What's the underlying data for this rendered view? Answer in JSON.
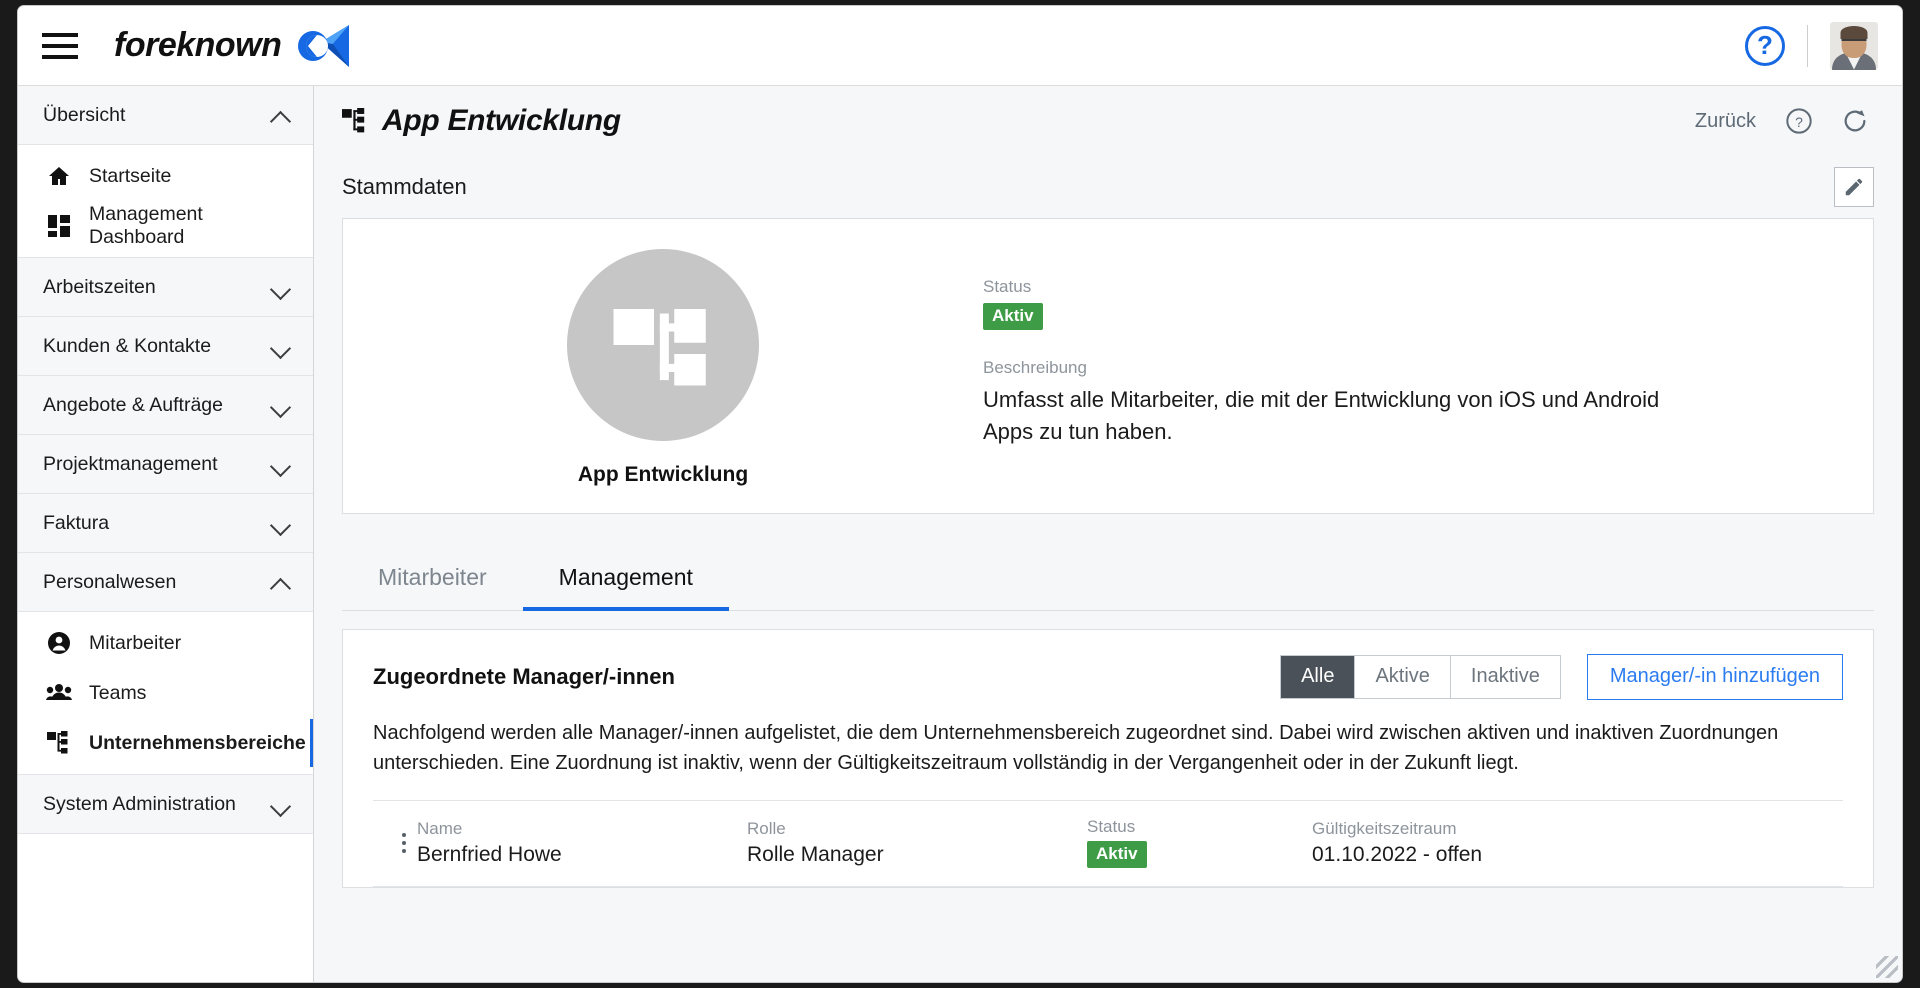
{
  "colors": {
    "accent_blue": "#1668e3",
    "link_blue": "#2b7cf0",
    "status_green": "#3d9c45",
    "segment_active": "#4b5158",
    "sidebar_group_bg": "#f6f7f9",
    "page_bg": "#f6f7f9"
  },
  "topbar": {
    "menu_icon": "hamburger-icon",
    "brand": "foreknown",
    "brand_logo_icon": "foreknown-logo-icon",
    "help_icon": "help-circle-icon",
    "avatar_icon": "user-avatar-photo"
  },
  "sidebar": {
    "groups": [
      {
        "label": "Übersicht",
        "expanded": true,
        "chevron": "chevron-up-icon",
        "items": [
          {
            "label": "Startseite",
            "icon": "home-icon",
            "active": false
          },
          {
            "label": "Management Dashboard",
            "icon": "dashboard-grid-icon",
            "active": false
          }
        ]
      },
      {
        "label": "Arbeitszeiten",
        "expanded": false,
        "chevron": "chevron-down-icon",
        "items": []
      },
      {
        "label": "Kunden & Kontakte",
        "expanded": false,
        "chevron": "chevron-down-icon",
        "items": []
      },
      {
        "label": "Angebote & Aufträge",
        "expanded": false,
        "chevron": "chevron-down-icon",
        "items": []
      },
      {
        "label": "Projektmanagement",
        "expanded": false,
        "chevron": "chevron-down-icon",
        "items": []
      },
      {
        "label": "Faktura",
        "expanded": false,
        "chevron": "chevron-down-icon",
        "items": []
      },
      {
        "label": "Personalwesen",
        "expanded": true,
        "chevron": "chevron-up-icon",
        "items": [
          {
            "label": "Mitarbeiter",
            "icon": "person-circle-icon",
            "active": false
          },
          {
            "label": "Teams",
            "icon": "people-group-icon",
            "active": false
          },
          {
            "label": "Unternehmensbereiche",
            "icon": "org-chart-icon",
            "active": true
          }
        ]
      },
      {
        "label": "System Administration",
        "expanded": false,
        "chevron": "chevron-down-icon",
        "items": []
      }
    ]
  },
  "page": {
    "title": "App Entwicklung",
    "title_icon": "org-chart-icon",
    "back_label": "Zurück",
    "help_icon": "help-circle-icon",
    "refresh_icon": "refresh-icon",
    "section_title": "Stammdaten",
    "edit_icon": "pencil-edit-icon"
  },
  "master_data": {
    "avatar_icon": "org-chart-icon",
    "org_name": "App Entwicklung",
    "status_label": "Status",
    "status_value": "Aktiv",
    "description_label": "Beschreibung",
    "description_value": "Umfasst alle Mitarbeiter, die mit der Entwicklung von iOS und Android Apps zu tun haben."
  },
  "tabs": [
    {
      "label": "Mitarbeiter",
      "active": false
    },
    {
      "label": "Management",
      "active": true
    }
  ],
  "managers_panel": {
    "title": "Zugeordnete Manager/-innen",
    "filters": [
      {
        "label": "Alle",
        "active": true
      },
      {
        "label": "Aktive",
        "active": false
      },
      {
        "label": "Inaktive",
        "active": false
      }
    ],
    "add_button": "Manager/-in hinzufügen",
    "description": "Nachfolgend werden alle Manager/-innen aufgelistet, die dem Unternehmensbereich zugeordnet sind. Dabei wird zwischen aktiven und inaktiven Zuordnungen unterschieden. Eine Zuordnung ist inaktiv, wenn der Gültigkeitszeitraum vollständig in der Vergangenheit oder in der Zukunft liegt.",
    "columns": {
      "name": "Name",
      "role": "Rolle",
      "status": "Status",
      "period": "Gültigkeitszeitraum"
    },
    "rows": [
      {
        "menu_icon": "kebab-menu-icon",
        "name": "Bernfried Howe",
        "role": "Rolle Manager",
        "status": "Aktiv",
        "period": "01.10.2022 - offen"
      }
    ]
  }
}
